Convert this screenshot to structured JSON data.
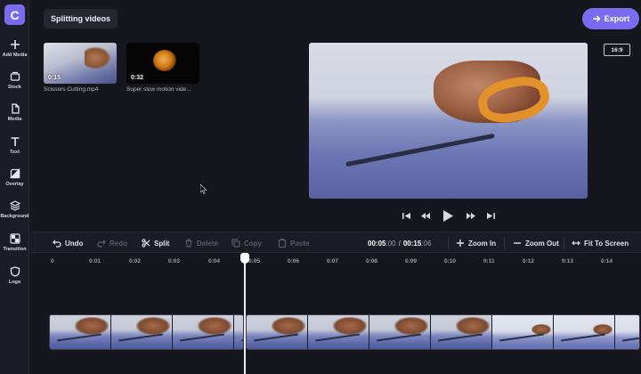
{
  "app": {
    "logo_letter": "C",
    "project_title": "Splitting videos",
    "export_label": "Export",
    "aspect_ratio": "16:9"
  },
  "sidebar": {
    "items": [
      {
        "label": "Add Media",
        "icon": "plus-icon"
      },
      {
        "label": "Stock",
        "icon": "stock-icon"
      },
      {
        "label": "Media",
        "icon": "media-icon"
      },
      {
        "label": "Text",
        "icon": "text-icon"
      },
      {
        "label": "Overlay",
        "icon": "overlay-icon"
      },
      {
        "label": "Background",
        "icon": "layers-icon"
      },
      {
        "label": "Transition",
        "icon": "transition-icon"
      },
      {
        "label": "Logo",
        "icon": "shield-icon"
      }
    ]
  },
  "media": {
    "items": [
      {
        "duration": "0:15",
        "name": "Scissors Cutting.mp4"
      },
      {
        "duration": "0:32",
        "name": "Super slow motion vide..."
      }
    ]
  },
  "toolbar": {
    "undo": "Undo",
    "redo": "Redo",
    "split": "Split",
    "delete": "Delete",
    "copy": "Copy",
    "paste": "Paste",
    "zoom_in": "Zoom In",
    "zoom_out": "Zoom Out",
    "fit": "Fit To Screen",
    "current_time": "00:05",
    "current_frames": ":00",
    "separator": "/",
    "total_time": "00:15",
    "total_frames": ":06"
  },
  "ruler": {
    "labels": [
      "0",
      "0:01",
      "0:02",
      "0:03",
      "0:04",
      "0:05",
      "0:06",
      "0:07",
      "0:08",
      "0:09",
      "0:10",
      "0:11",
      "0:12",
      "0:13",
      "0:14"
    ]
  },
  "colors": {
    "accent": "#7a6cf0",
    "background": "#16161f",
    "panel": "#1c1c26"
  }
}
